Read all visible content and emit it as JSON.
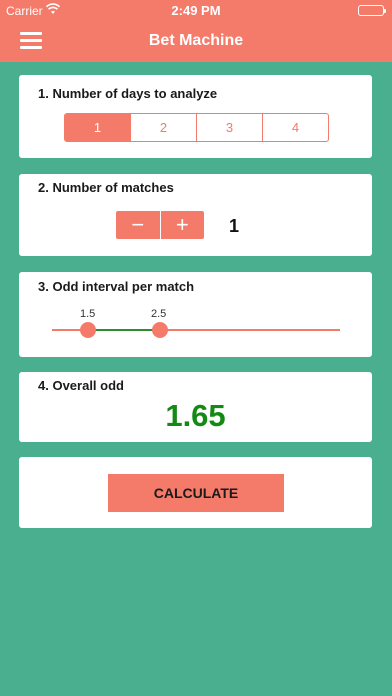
{
  "status_bar": {
    "carrier": "Carrier",
    "time": "2:49 PM"
  },
  "nav": {
    "title": "Bet Machine",
    "menu_icon": "hamburger-menu-icon"
  },
  "days": {
    "title": "1. Number of days to analyze",
    "options": [
      "1",
      "2",
      "3",
      "4"
    ],
    "selected": "1"
  },
  "matches": {
    "title": "2. Number of matches",
    "minus_label": "−",
    "plus_label": "+",
    "value": "1"
  },
  "interval": {
    "title": "3. Odd interval per match",
    "low": "1.5",
    "high": "2.5"
  },
  "overall": {
    "title": "4. Overall odd",
    "value": "1.65"
  },
  "actions": {
    "calculate_label": "CALCULATE"
  },
  "colors": {
    "accent": "#f47a6a",
    "background": "#4aaf8f",
    "odd_value": "#148a14",
    "range": "#2e8b2e"
  }
}
